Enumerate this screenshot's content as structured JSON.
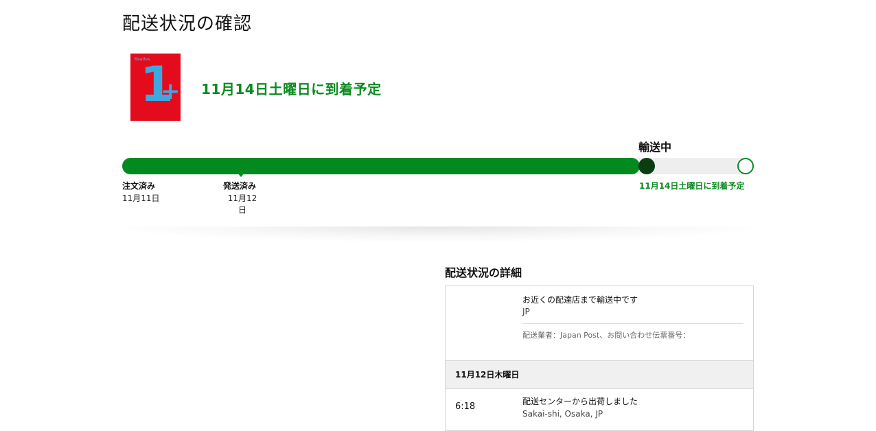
{
  "page": {
    "title": "配送状況の確認"
  },
  "product": {
    "image_band_text": "Beatles",
    "image_number": "1",
    "image_plus": "+",
    "image_colors": {
      "background": "#e30b1c",
      "artwork": "#3fa7e0"
    }
  },
  "arrival": {
    "headline": "11月14日土曜日に到着予定",
    "color": "#0b8a1f"
  },
  "progress": {
    "current_status": "輸送中",
    "fill_fraction": 0.82,
    "fill_color": "#028a20",
    "milestones": [
      {
        "label": "注文済み",
        "date": "11月11日"
      },
      {
        "label": "発送済み",
        "date": "11月12\n日"
      }
    ],
    "arrival_label": "11月14日土曜日に到着予定"
  },
  "details": {
    "heading": "配送状況の詳細",
    "latest_event": {
      "description": "お近くの配達店まで輸送中です",
      "location": "JP",
      "carrier_line": "配送業者：Japan Post、お問い合わせ伝票番号："
    },
    "days": [
      {
        "date": "11月12日木曜日",
        "events": [
          {
            "time": "6:18",
            "description": "配送センターから出荷しました",
            "location": "Sakai-shi, Osaka, JP"
          }
        ]
      }
    ]
  }
}
